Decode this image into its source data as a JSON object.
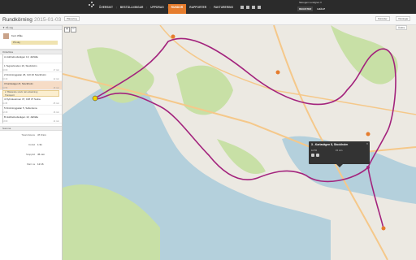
{
  "nav": {
    "items": [
      "ÖVERSIKT",
      "BESTÄLLNINGAR",
      "UPPDRAG",
      "RUNDOR",
      "RAPPORTER",
      "FAKTURERING"
    ],
    "active": "RUNDOR",
    "icons": [
      "grid-icon",
      "list-icon",
      "settings-icon",
      "help-icon"
    ],
    "user": "Skoogen Lundgren ▾",
    "links": [
      "REGISTER",
      "HJÄLP"
    ]
  },
  "header": {
    "title": "Rundkörning",
    "date": "2015-01-03",
    "print_label": "Planering",
    "follow_label": "Körorder",
    "display_label": "Visningar",
    "edit_label": "Ändra"
  },
  "sidebar": {
    "section_driver": "▼ På väg",
    "driver_name": "Kent Wåle",
    "driver_bar": "På väg",
    "section_stops": "Orderlista",
    "stops": [
      {
        "text": "A  Hobbebodsvägen 13, Järfälla",
        "t1": "",
        "t2": ""
      },
      {
        "text": "1  Tegnérlunden 16, Stockholm",
        "t1": "10:00",
        "t2": "17 min"
      },
      {
        "text": "2  Drottninggatan 26, 110 20 Stockholm",
        "t1": "10:40",
        "t2": "12 min"
      },
      {
        "text": "3  Karlavägen 8, Stockholm",
        "t1": "10:55",
        "t2": "15 min"
      },
      {
        "text": "4  Nybrokvarnen 37, 168 37 Solna",
        "t1": "11:45",
        "t2": "25 min"
      },
      {
        "text": "5  Drottninggatan 5, Sollentuna",
        "t1": "12:30",
        "t2": "16 min"
      },
      {
        "text": "B  Hobbebodsvägen 13, Järfälla",
        "t1": "13:00",
        "t2": "14 min"
      }
    ],
    "note": "2. Blekande stock när avlastning\nTransport",
    "section_summary": "Summa",
    "summary": [
      {
        "k": "Total distans",
        "v": "47.3 km"
      },
      {
        "k": "Körtid",
        "v": "1:31"
      },
      {
        "k": "Stopptid",
        "v": "45 min"
      },
      {
        "k": "Klart ca",
        "v": "12:16"
      }
    ]
  },
  "map": {
    "zoom_in": "+",
    "zoom_out": "−",
    "popup": {
      "title": "3 - Karlavägen 8, Stockholm",
      "a": "10:55",
      "b": "15 min",
      "close": "×"
    },
    "colors": {
      "route": "#a3237d",
      "water": "#b4d0dc",
      "land": "#ece9e2",
      "park": "#c8e0a6",
      "road": "#f5c88a"
    }
  }
}
